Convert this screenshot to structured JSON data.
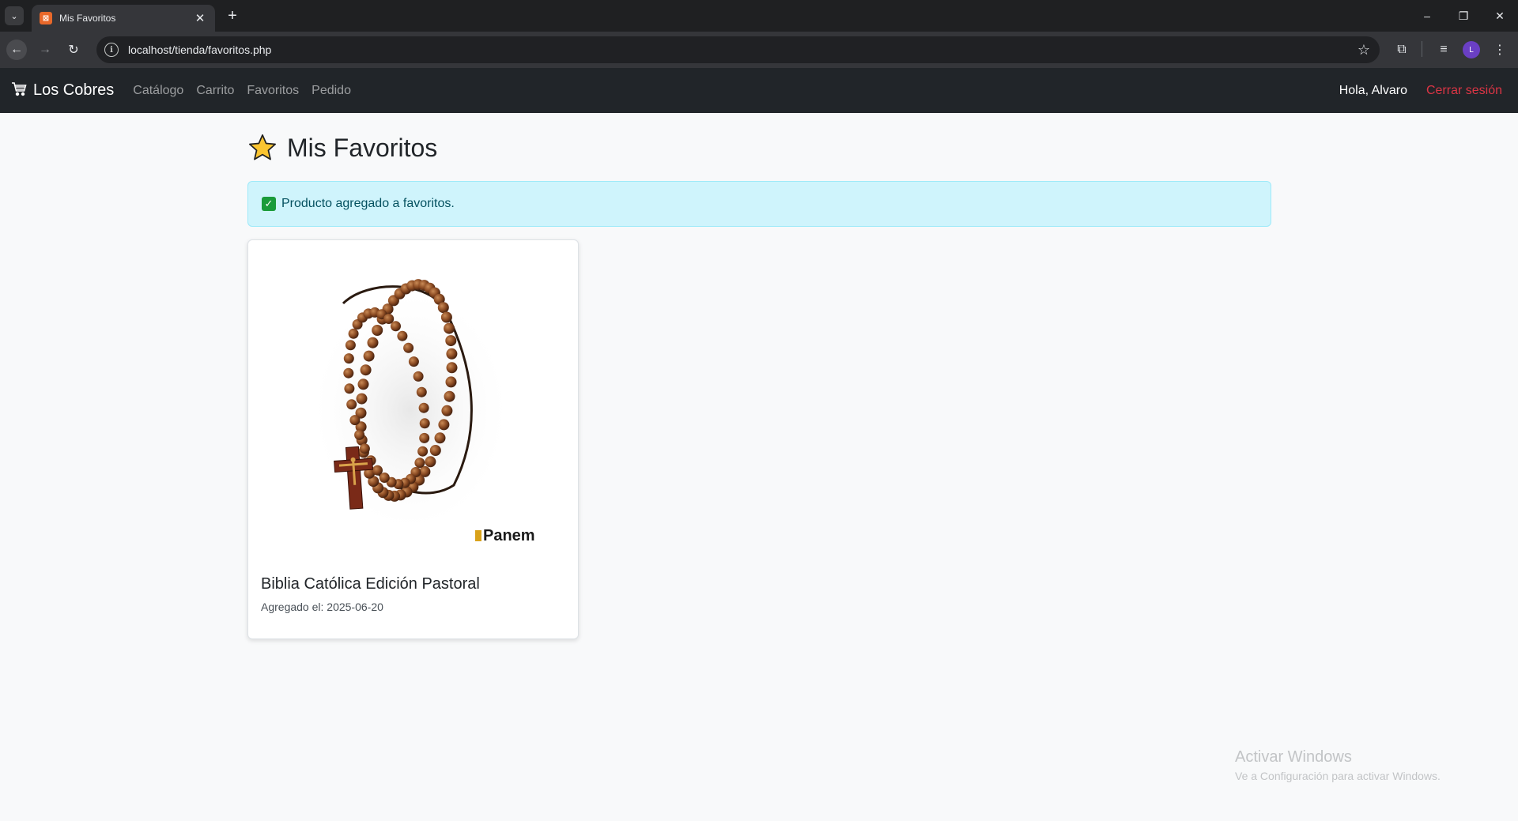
{
  "browser": {
    "tab": {
      "title": "Mis Favoritos",
      "favicon": "xampp-icon"
    },
    "url": "localhost/tienda/favoritos.php",
    "profile_initial": "L"
  },
  "navbar": {
    "brand": "Los Cobres",
    "brand_icon": "cart-icon",
    "links": [
      {
        "label": "Catálogo"
      },
      {
        "label": "Carrito"
      },
      {
        "label": "Favoritos"
      },
      {
        "label": "Pedido"
      }
    ],
    "greeting": "Hola, Alvaro",
    "logout": "Cerrar sesión"
  },
  "page": {
    "title": "Mis Favoritos",
    "title_icon": "star-icon",
    "alert": {
      "icon": "check-mark-icon",
      "text": "Producto agregado a favoritos."
    },
    "favorites": [
      {
        "title": "Biblia Católica Edición Pastoral",
        "date": "Agregado el: 2025-06-20",
        "image_icon": "rosary-image",
        "image_logo": "Panem"
      }
    ]
  },
  "watermark": {
    "title": "Activar Windows",
    "subtitle": "Ve a Configuración para activar Windows."
  },
  "colors": {
    "navbar_bg": "#212529",
    "logout": "#dc3545",
    "alert_bg": "#cff4fc",
    "alert_text": "#055160",
    "page_bg": "#f8f9fa"
  }
}
